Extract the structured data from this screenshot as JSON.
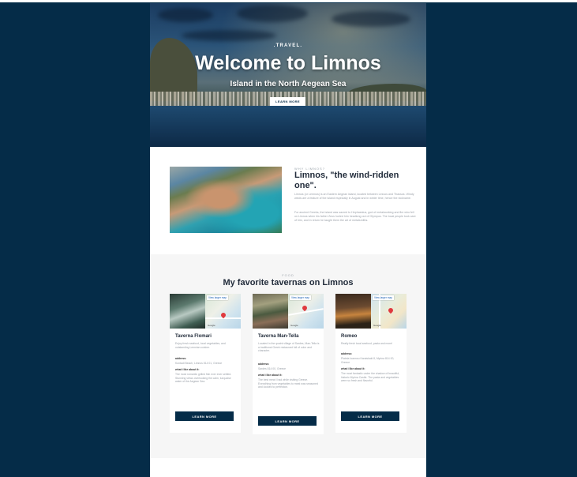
{
  "hero": {
    "kicker": ".TRAVEL.",
    "title": "Welcome to Limnos",
    "subtitle": "Island in the North Aegean Sea",
    "button": "LEARN MORE"
  },
  "intro": {
    "kicker": "WHY LIMNOS?",
    "title": "Limnos, \"the wind-ridden one\".",
    "paragraph1": "Limnos (or Lemnos) is an Eastern Aegean island, located between Lesvos and Thassos. Windy winds are a feature of the island especially in August and in winter time, hence the nickname.",
    "paragraph2": "For ancient Greeks, the island was sacred to Hephaestus, god of metalworking and fire who fell on Limnos when his father Zeus hurled him headlong out of Olympus. The local people took care of him, and in return he taught them the art of metalsmiths."
  },
  "tavernas": {
    "kicker": "FOOD",
    "title": "My favorite tavernas on Limnos",
    "map_tag": "View larger map",
    "map_logo": "Google",
    "address_label": "address:",
    "why_label": "what i like about it:",
    "button": "LEARN MORE",
    "items": [
      {
        "name": "Taverna Flomari",
        "desc": "Enjoy fresh seafood, local vegetables, and outstanding Lemnian cuisine.",
        "address": "Kontadi Beach, Limnos 814 01, Greece",
        "why": "The most romantic grilled fish ever ever settled. Stunning views overlooking the calm, turquoise water of the Aegean Sea."
      },
      {
        "name": "Taverna Man-Tella",
        "desc": "Located in the quaint village of Sardes, Man-Tella is a traditional Greek restaurant full of color and character.",
        "address": "Sardes 814 00, Greece",
        "why": "The best meat I had while visiting Greece. Everything from vegetables to meat was seasoned and cooked to perfection."
      },
      {
        "name": "Romeo",
        "desc": "Really fresh local seafood, pasta and more!",
        "address": "Plateia Ioannou Karaiskaki 8, Myrina 814 00, Greece",
        "why": "The most fantastic under the shadow of beautiful, historic Myrina Castle. The pasta and vegetables were so fresh and flavorful."
      }
    ]
  }
}
